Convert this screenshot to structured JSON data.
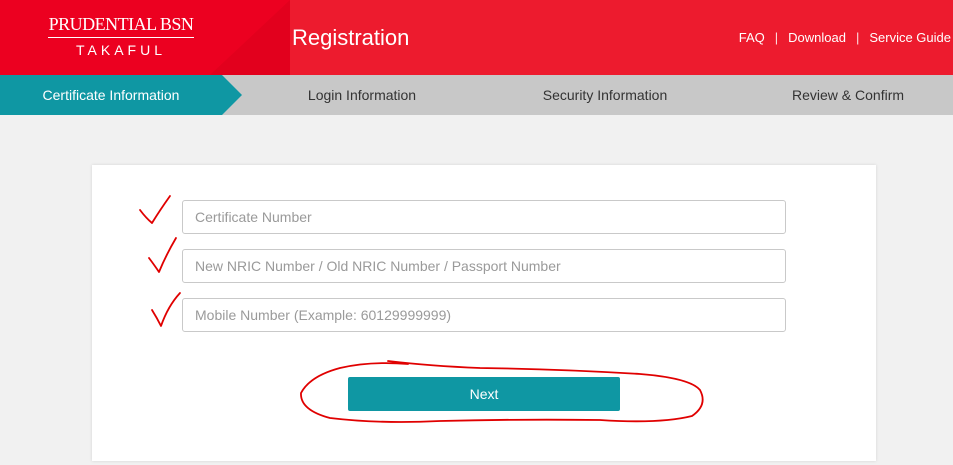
{
  "header": {
    "logo": {
      "brand": "PRUDENTIAL BSN",
      "sub": "TAKAFUL"
    },
    "title": "Registration",
    "links": [
      "FAQ",
      "Download",
      "Service Guide"
    ],
    "link_separator": "|",
    "colors": {
      "header_red": "#ed1b2e",
      "accent_teal": "#0f97a3"
    }
  },
  "steps": [
    {
      "label": "Certificate Information",
      "active": true
    },
    {
      "label": "Login Information",
      "active": false
    },
    {
      "label": "Security Information",
      "active": false
    },
    {
      "label": "Review & Confirm",
      "active": false
    }
  ],
  "form": {
    "certificate": {
      "value": "",
      "placeholder": "Certificate Number"
    },
    "nric": {
      "value": "",
      "placeholder": "New NRIC Number / Old NRIC Number / Passport Number"
    },
    "mobile": {
      "value": "",
      "placeholder": "Mobile Number (Example: 60129999999)"
    },
    "next_label": "Next"
  },
  "annotations": {
    "marks": [
      "checkmark-icon",
      "checkmark-icon",
      "checkmark-icon",
      "circle-highlight"
    ],
    "color": "#e00000"
  }
}
